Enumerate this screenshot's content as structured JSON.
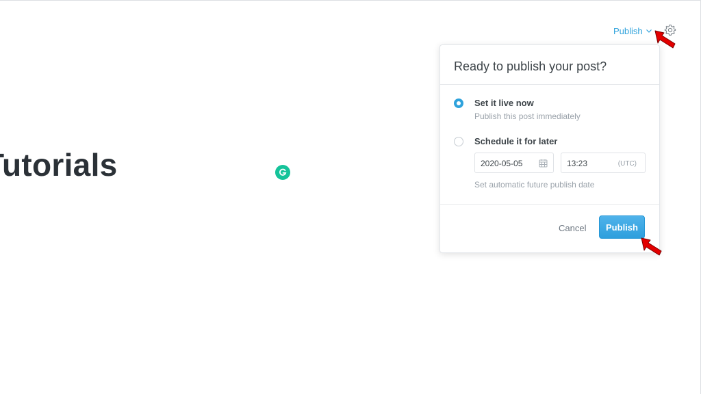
{
  "editor": {
    "title": "Tutorials"
  },
  "header": {
    "publish_label": "Publish"
  },
  "publish_menu": {
    "title": "Ready to publish your post?",
    "options": [
      {
        "label": "Set it live now",
        "description": "Publish this post immediately",
        "selected": true
      },
      {
        "label": "Schedule it for later",
        "selected": false
      }
    ],
    "schedule": {
      "date": "2020-05-05",
      "time": "13:23",
      "timezone": "(UTC)",
      "helper": "Set automatic future publish date"
    },
    "cancel_label": "Cancel",
    "publish_label": "Publish"
  },
  "icons": {
    "settings": "gear-icon",
    "dropdown": "chevron-down-icon",
    "calendar": "calendar-icon",
    "grammarly": "grammarly-icon"
  },
  "colors": {
    "accent": "#2ea2dc",
    "grammarly": "#15c39a",
    "annotation_arrow": "#e30000"
  }
}
